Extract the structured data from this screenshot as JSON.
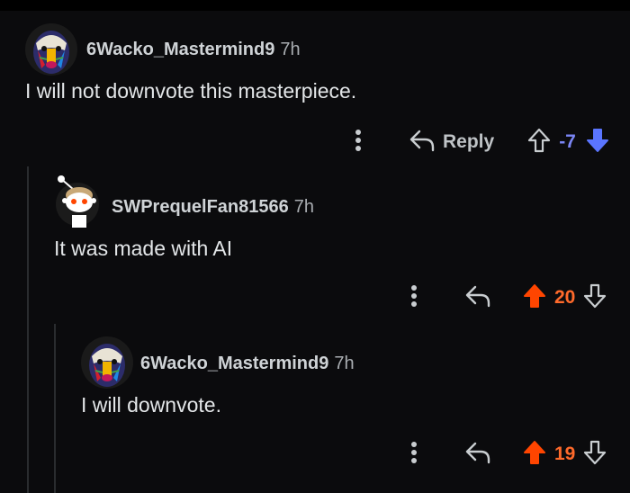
{
  "comments": [
    {
      "username": "6Wacko_Mastermind9",
      "time": "7h",
      "text": "I will not downvote this masterpiece.",
      "reply_label": "Reply",
      "score": "-7",
      "score_color": "#7b86f5",
      "vote_state": "downvoted"
    },
    {
      "username": "SWPrequelFan81566",
      "time": "7h",
      "text": "It was made with AI",
      "score": "20",
      "score_color": "#ff6a2b",
      "vote_state": "upvoted"
    },
    {
      "username": "6Wacko_Mastermind9",
      "time": "7h",
      "text": "I will downvote.",
      "score": "19",
      "score_color": "#ff6a2b",
      "vote_state": "upvoted"
    }
  ],
  "icons": {
    "more": "more-vertical-icon",
    "reply": "reply-arrow-icon",
    "upvote": "upvote-arrow-icon",
    "downvote": "downvote-arrow-icon"
  },
  "colors": {
    "upvote_active": "#ff4500",
    "downvote_active": "#5a75ff",
    "muted_icon": "#c9cdd0"
  }
}
